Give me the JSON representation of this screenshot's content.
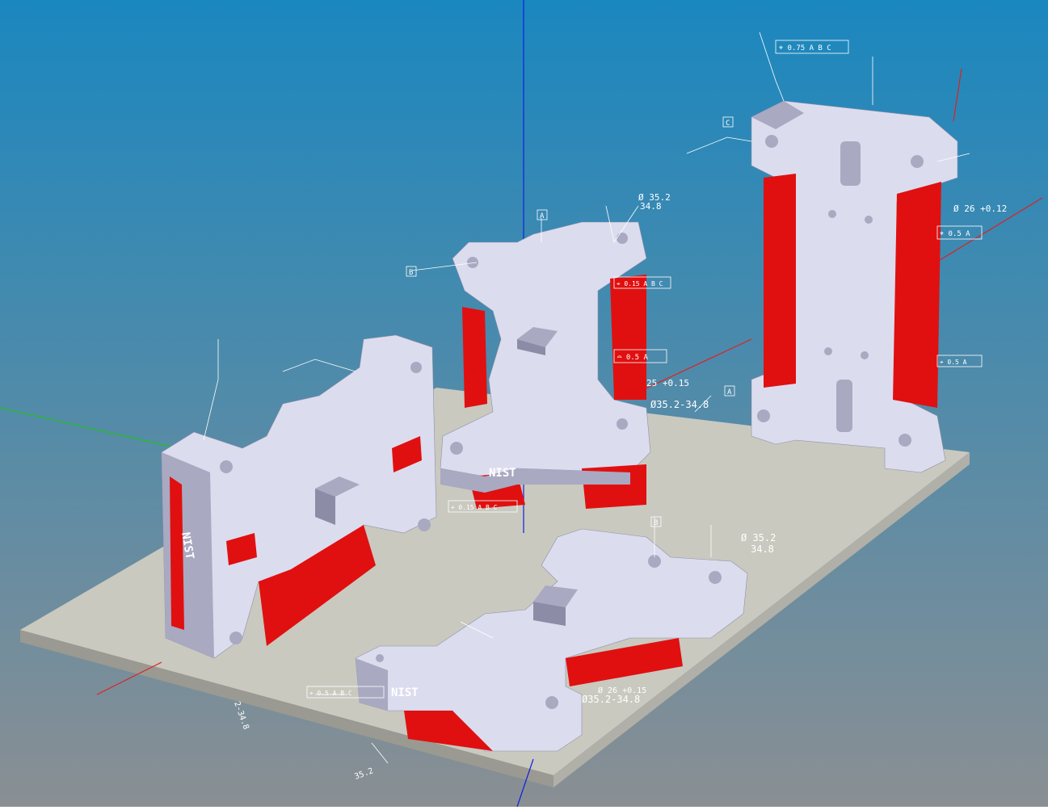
{
  "scene": {
    "colors": {
      "bg_top": "#1a87bf",
      "bg_bottom": "#8a8f93",
      "plate": "#c9c9c0",
      "part": "#dcdcef",
      "part_shade": "#a9a9c2",
      "feature_red": "#e01010",
      "annotation": "#ffffff",
      "axis_x": "#e02020",
      "axis_y": "#20c020",
      "axis_z": "#1020e0"
    }
  },
  "annotations": {
    "dim_a1": "Ø 35.2",
    "dim_a2": "34.8",
    "dim_b1": "Ø35.2-34.8",
    "dim_c1": "Ø35.2-34.8",
    "dim_d1": "Ø 35.2",
    "dim_d2": "34.8",
    "dim_e1": "25 +0.15",
    "dim_f1": "Ø 26 +0.12",
    "dim_g1": "Ø 26 +0.15",
    "fcf_1": "⌖ 0.75 A B C",
    "fcf_2": "⌓ 0.5 A",
    "fcf_3": "⌖ 0.5 A",
    "fcf_4": "⌖ 0.15 A B C",
    "fcf_5": "⌖ 0.5 A B C",
    "datum_a": "A",
    "datum_b": "B",
    "datum_c": "C",
    "nist_logo": "NIST",
    "dim_h1": "2-34.8",
    "dim_h2": "35.2"
  }
}
